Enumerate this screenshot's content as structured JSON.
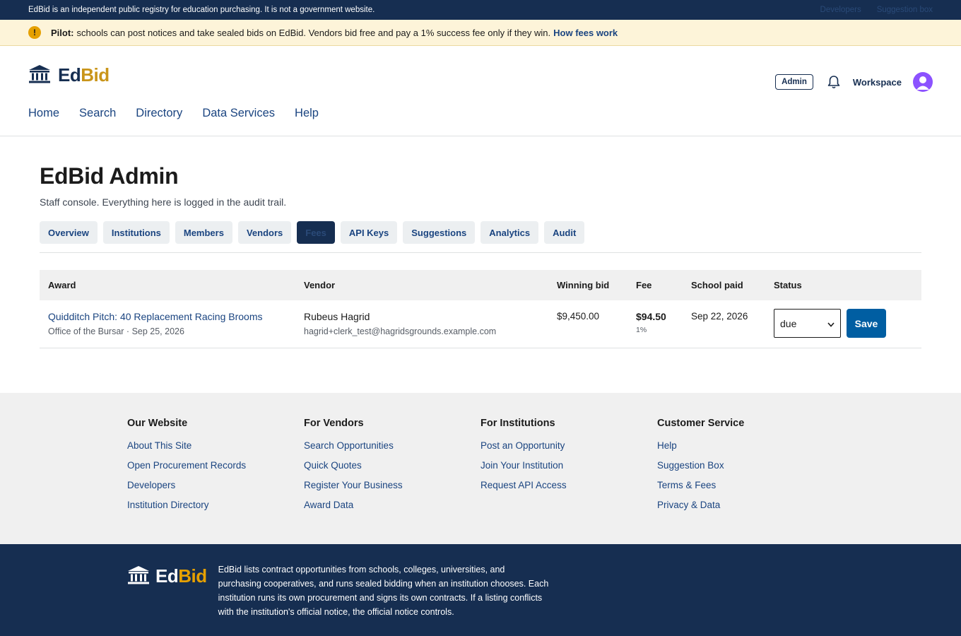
{
  "topbar": {
    "notice": "EdBid is an independent public registry for education purchasing. It is not a government website.",
    "links": [
      "Developers",
      "Suggestion box"
    ]
  },
  "pilot": {
    "label": "Pilot:",
    "text": "schools can post notices and take sealed bids on EdBid. Vendors bid free and pay a 1% success fee only if they win.",
    "link": "How fees work"
  },
  "header": {
    "logo_ed": "Ed",
    "logo_bid": "Bid",
    "nav": [
      "Home",
      "Search",
      "Directory",
      "Data Services",
      "Help"
    ],
    "admin_badge": "Admin",
    "workspace": "Workspace"
  },
  "main": {
    "title": "EdBid Admin",
    "subtitle": "Staff console. Everything here is logged in the audit trail.",
    "tabs": [
      {
        "label": "Overview"
      },
      {
        "label": "Institutions"
      },
      {
        "label": "Members"
      },
      {
        "label": "Vendors"
      },
      {
        "label": "Fees"
      },
      {
        "label": "API Keys"
      },
      {
        "label": "Suggestions"
      },
      {
        "label": "Analytics"
      },
      {
        "label": "Audit"
      }
    ],
    "active_tab": "Fees"
  },
  "table": {
    "headers": [
      "Award",
      "Vendor",
      "Winning bid",
      "Fee",
      "School paid",
      "Status"
    ],
    "rows": [
      {
        "award": "Quidditch Pitch: 40 Replacement Racing Brooms",
        "award_meta": "Office of the Bursar · Sep 25, 2026",
        "vendor": "Rubeus Hagrid",
        "vendor_email": "hagrid+clerk_test@hagridsgrounds.example.com",
        "winning_bid": "$9,450.00",
        "fee": "$94.50",
        "fee_pct": "1%",
        "school_paid": "Sep 22, 2026",
        "status": "due",
        "save": "Save"
      }
    ]
  },
  "footer": {
    "columns": [
      {
        "title": "Our Website",
        "links": [
          "About This Site",
          "Open Procurement Records",
          "Developers",
          "Institution Directory"
        ]
      },
      {
        "title": "For Vendors",
        "links": [
          "Search Opportunities",
          "Quick Quotes",
          "Register Your Business",
          "Award Data"
        ]
      },
      {
        "title": "For Institutions",
        "links": [
          "Post an Opportunity",
          "Join Your Institution",
          "Request API Access"
        ]
      },
      {
        "title": "Customer Service",
        "links": [
          "Help",
          "Suggestion Box",
          "Terms & Fees",
          "Privacy & Data"
        ]
      }
    ],
    "about": "EdBid lists contract opportunities from schools, colleges, universities, and purchasing cooperatives, and runs sealed bidding when an institution chooses. Each institution runs its own procurement and signs its own contracts. If a listing conflicts with the institution's official notice, the official notice controls."
  },
  "colors": {
    "navy": "#162e51",
    "gold": "#c9951a",
    "link": "#1a4480",
    "primary_button": "#005ea2",
    "avatar": "#8c52ff",
    "pilot_bg": "#fdf4d9"
  },
  "icons": [
    "warning-icon",
    "institution-icon",
    "bell-icon",
    "user-avatar-icon",
    "chevron-down-icon"
  ]
}
